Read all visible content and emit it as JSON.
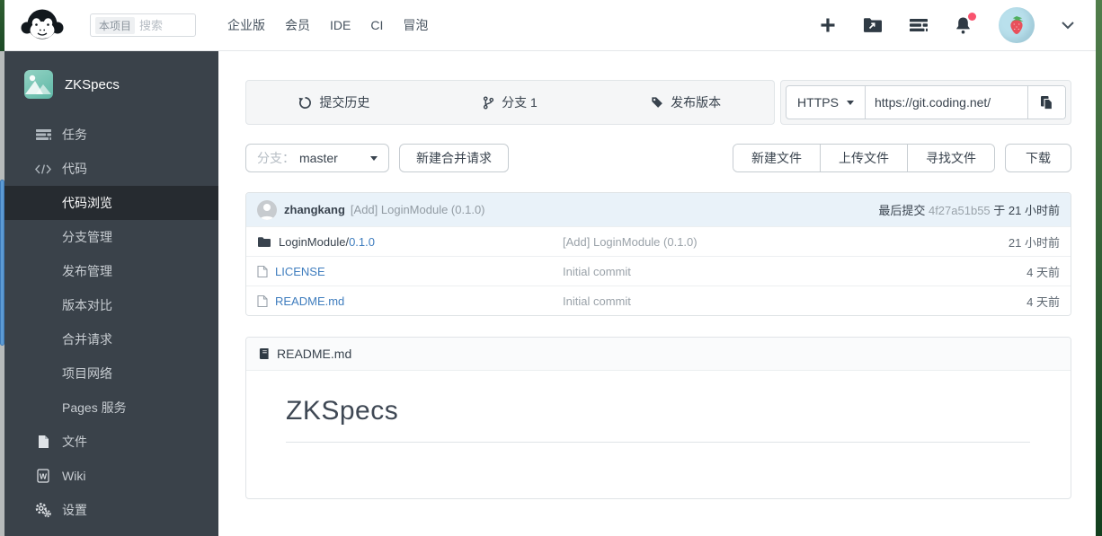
{
  "colors": {
    "link_blue": "#3f7dbe",
    "notification_dot": "#f9536e",
    "sidebar_bg": "#3a424a",
    "commit_header_bg": "#e9f2f9"
  },
  "navbar": {
    "search": {
      "scope": "本项目",
      "placeholder": "搜索"
    },
    "links": [
      "企业版",
      "会员",
      "IDE",
      "CI",
      "冒泡"
    ],
    "icons": [
      "plus-icon",
      "project-switcher-icon",
      "tasks-icon",
      "bell-icon",
      "user-avatar",
      "chevron-down-icon"
    ],
    "has_notification_dot": true
  },
  "sidebar": {
    "project_name": "ZKSpecs",
    "items": [
      {
        "label": "任务",
        "icon": "tasks-icon"
      },
      {
        "label": "代码",
        "icon": "code-icon"
      },
      {
        "label": "代码浏览",
        "sub": true,
        "active": true
      },
      {
        "label": "分支管理",
        "sub": true
      },
      {
        "label": "发布管理",
        "sub": true
      },
      {
        "label": "版本对比",
        "sub": true
      },
      {
        "label": "合并请求",
        "sub": true
      },
      {
        "label": "项目网络",
        "sub": true
      },
      {
        "label": "Pages 服务",
        "sub": true
      },
      {
        "label": "文件",
        "icon": "file-icon"
      },
      {
        "label": "Wiki",
        "icon": "wiki-icon"
      },
      {
        "label": "设置",
        "icon": "settings-icon"
      }
    ]
  },
  "toolbar": {
    "tabs": [
      {
        "label": "提交历史",
        "icon": "history-icon"
      },
      {
        "label": "分支 1",
        "icon": "branch-icon"
      },
      {
        "label": "发布版本",
        "icon": "tag-icon"
      }
    ],
    "protocol": "HTTPS",
    "clone_url": "https://git.coding.net/"
  },
  "branch_bar": {
    "branch_label": "分支：",
    "branch_value": "master",
    "new_merge_request": "新建合并请求",
    "file_actions": [
      "新建文件",
      "上传文件",
      "寻找文件"
    ],
    "download": "下载"
  },
  "commit_header": {
    "author": "zhangkang",
    "message": "[Add] LoginModule (0.1.0)",
    "last_commit_label": "最后提交",
    "commit_hash": "4f27a51b55",
    "at_label": "于",
    "time": "21 小时前"
  },
  "files": [
    {
      "type": "folder",
      "name": "LoginModule/",
      "version_link": "0.1.0",
      "message": "[Add] LoginModule (0.1.0)",
      "time": "21 小时前"
    },
    {
      "type": "file",
      "name": "LICENSE",
      "message": "Initial commit",
      "time": "4 天前"
    },
    {
      "type": "file",
      "name": "README.md",
      "message": "Initial commit",
      "time": "4 天前"
    }
  ],
  "readme": {
    "filename": "README.md",
    "heading": "ZKSpecs"
  }
}
